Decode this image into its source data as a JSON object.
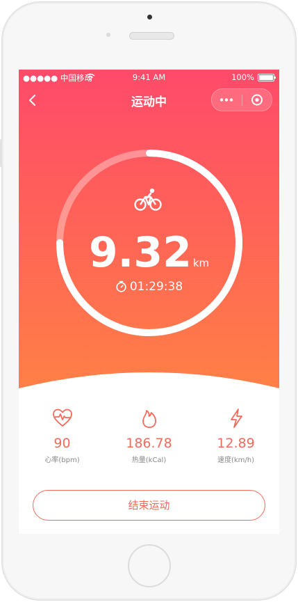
{
  "status_bar": {
    "carrier": "●●●●● 中国移动",
    "time": "9:41 AM",
    "battery": "100%"
  },
  "nav": {
    "title": "运动中"
  },
  "workout": {
    "distance": "9.32",
    "unit": "km",
    "duration": "01:29:38",
    "progress": 0.75
  },
  "stats": [
    {
      "value": "90",
      "label": "心率(bpm)",
      "icon": "heart-rate-icon"
    },
    {
      "value": "186.78",
      "label": "热量(kCal)",
      "icon": "flame-icon"
    },
    {
      "value": "12.89",
      "label": "速度(km/h)",
      "icon": "lightning-icon"
    }
  ],
  "actions": {
    "end_label": "结束运动"
  },
  "colors": {
    "gradient_top": "#ff4a6a",
    "gradient_bottom": "#ff8145",
    "accent": "#f26b5b"
  }
}
